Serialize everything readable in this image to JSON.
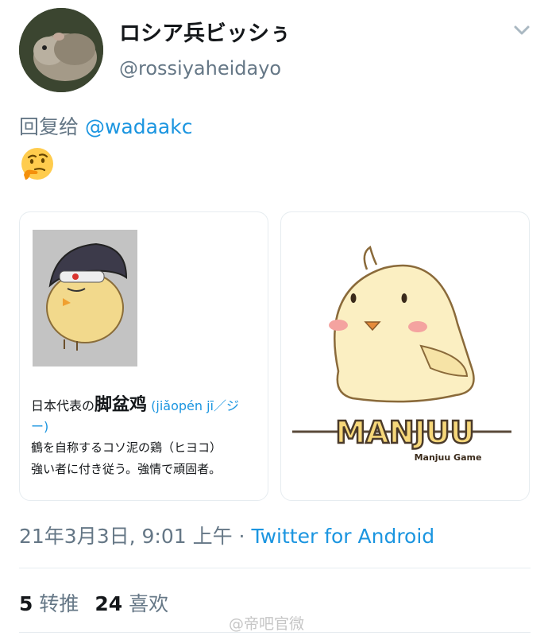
{
  "user": {
    "display_name": "ロシア兵ビッシぅ",
    "handle": "@rossiyaheidayo"
  },
  "tweet": {
    "reply_prefix": "回复给",
    "reply_to": "@wadaakc",
    "emoji": "thinking-face-icon"
  },
  "cards": {
    "left": {
      "caption_prefix": "日本代表の",
      "term": "脚盆鸡",
      "pinyin": "(jiǎopén jī／ジ",
      "pinyin_cont": "ー)",
      "desc_line1": "鶴を自称するコソ泥の鶏（ヒヨコ）",
      "desc_line2": "強い者に付き従う。強情で頑固者。"
    },
    "right": {
      "logo_text": "MANJUU",
      "logo_sub": "Manjuu Game"
    }
  },
  "meta": {
    "timestamp": "21年3月3日, 9:01 上午",
    "separator": " · ",
    "source": "Twitter for Android"
  },
  "stats": {
    "retweets_count": "5",
    "retweets_label": "转推",
    "likes_count": "24",
    "likes_label": "喜欢"
  },
  "watermark": "@帝吧官微",
  "colors": {
    "link": "#1b95e0",
    "secondary": "#657786",
    "primary": "#14171a"
  }
}
